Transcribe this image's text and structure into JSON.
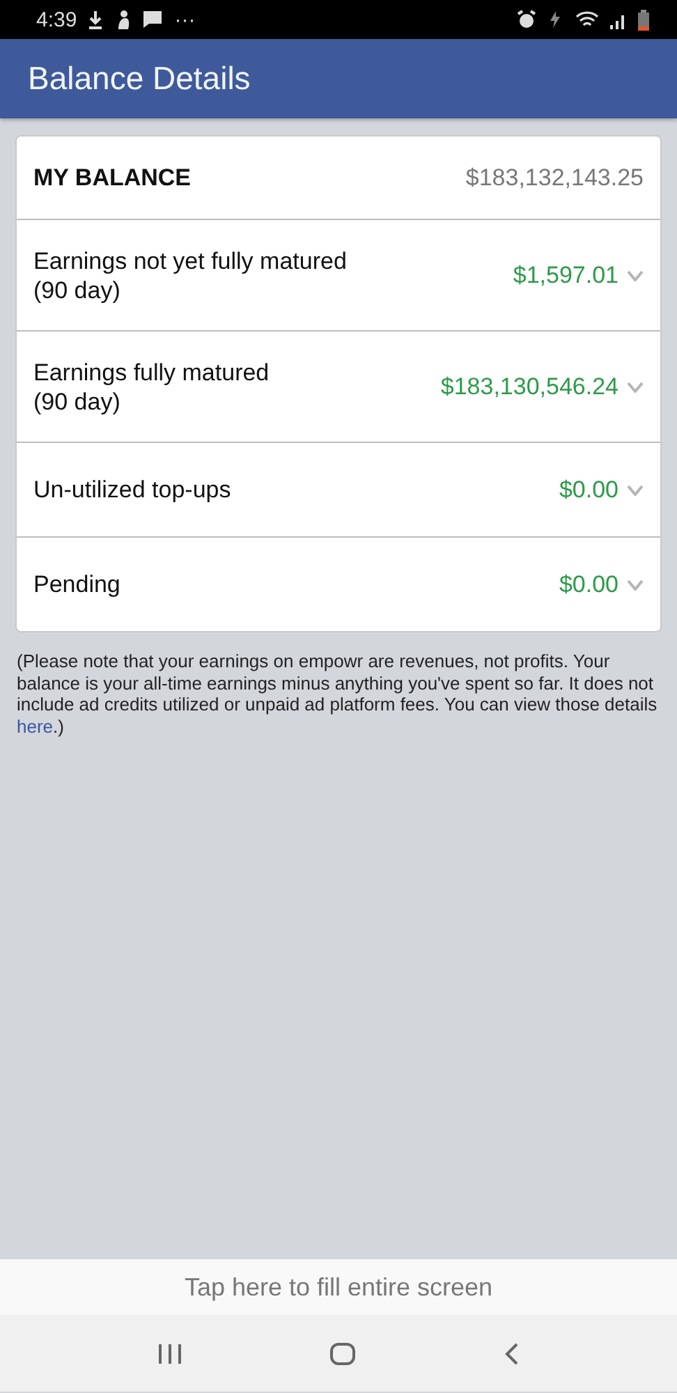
{
  "status_bar": {
    "time": "4:39",
    "more": "···"
  },
  "app_bar": {
    "title": "Balance Details"
  },
  "balance": {
    "label": "MY BALANCE",
    "amount": "$183,132,143.25"
  },
  "rows": [
    {
      "label": "Earnings not yet fully matured\n(90 day)",
      "amount": "$1,597.01",
      "expanded": false
    },
    {
      "label": "Earnings fully matured\n(90 day)",
      "amount": "$183,130,546.24",
      "expanded": false
    },
    {
      "label": "Un-utilized top-ups",
      "amount": "$0.00",
      "expanded": false
    },
    {
      "label": "Pending",
      "amount": "$0.00",
      "expanded": false
    }
  ],
  "note": {
    "text": "(Please note that your earnings on empowr are revenues, not profits. Your balance is your all-time earnings minus anything you've spent so far. It does not include ad credits utilized or unpaid ad platform fees. You can view those details ",
    "link": "here",
    "after": ".)"
  },
  "banner": {
    "text": "Tap here to fill entire screen"
  }
}
